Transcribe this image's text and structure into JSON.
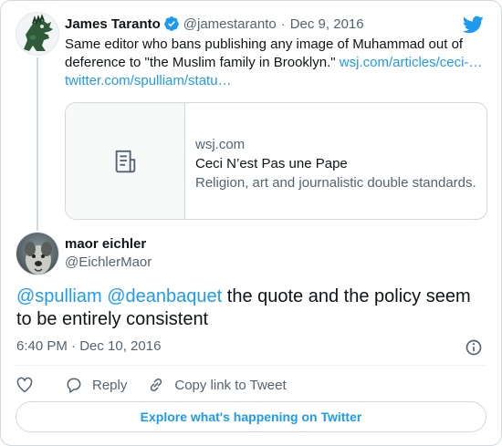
{
  "parent_tweet": {
    "author_name": "James Taranto",
    "handle": "@jamestaranto",
    "separator": "·",
    "date": "Dec 9, 2016",
    "text": "Same editor who bans publishing any image of Muhammad out of deference to \"the Muslim family in Brooklyn.\"",
    "link1": "wsj.com/articles/ceci-…",
    "link2": "twitter.com/spulliam/statu…",
    "preview": {
      "domain": "wsj.com",
      "title": "Ceci N’est Pas une Pape",
      "description": "Religion, art and journalistic double standards."
    }
  },
  "reply_tweet": {
    "author_name": "maor eichler",
    "handle": "@EichlerMaor",
    "mention1": "@spulliam",
    "mention2": "@deanbaquet",
    "text": "the quote and the policy seem to be entirely consistent",
    "timestamp": "6:40 PM · Dec 10, 2016"
  },
  "actions": {
    "reply_label": "Reply",
    "copy_label": "Copy link to Tweet"
  },
  "footer": {
    "explore_label": "Explore what's happening on Twitter"
  },
  "colors": {
    "accent": "#1d9bf0",
    "text": "#0f1419",
    "muted": "#536471",
    "border": "#cfd9de"
  },
  "icons": [
    "bird-icon",
    "verified-badge-icon",
    "document-icon",
    "info-icon",
    "heart-icon",
    "reply-icon",
    "link-icon"
  ]
}
